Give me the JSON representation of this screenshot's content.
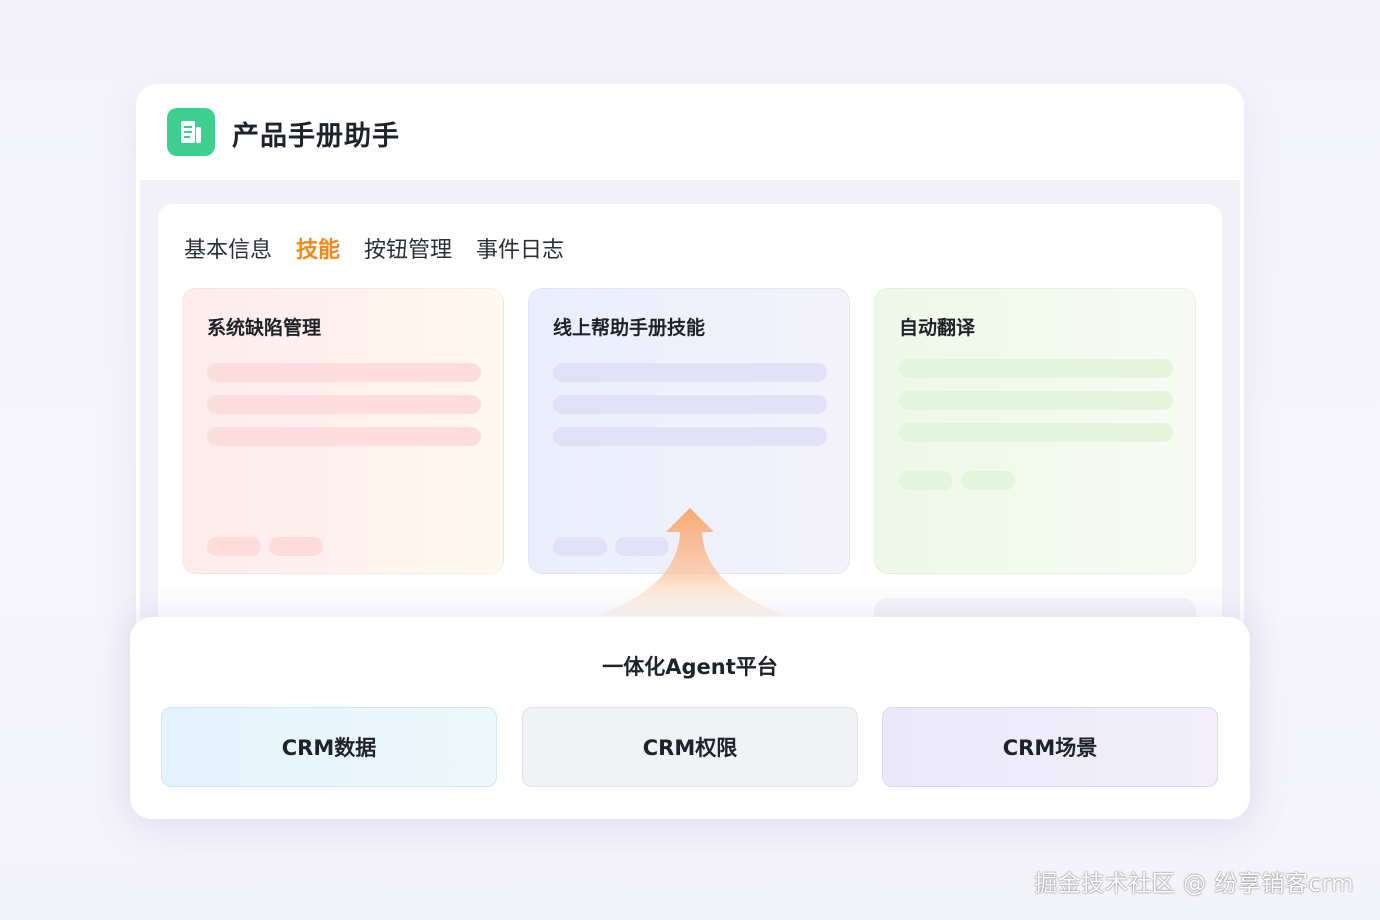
{
  "app": {
    "title": "产品手册助手",
    "accent": "#3ecf8e"
  },
  "tabs": [
    {
      "label": "基本信息",
      "active": false
    },
    {
      "label": "技能",
      "active": true
    },
    {
      "label": "按钮管理",
      "active": false
    },
    {
      "label": "事件日志",
      "active": false
    }
  ],
  "active_tab_color": "#f08a14",
  "skill_cards": [
    {
      "title": "系统缺陷管理",
      "color": "#fcdcdc"
    },
    {
      "title": "线上帮助手册技能",
      "color": "#e2e0f7"
    },
    {
      "title": "自动翻译",
      "color": "#e4f5dc"
    }
  ],
  "platform": {
    "title": "一体化Agent平台",
    "buttons": [
      {
        "label": "CRM数据"
      },
      {
        "label": "CRM权限"
      },
      {
        "label": "CRM场景"
      }
    ]
  },
  "watermark": "掘金技术社区 @ 纷享销客crm"
}
